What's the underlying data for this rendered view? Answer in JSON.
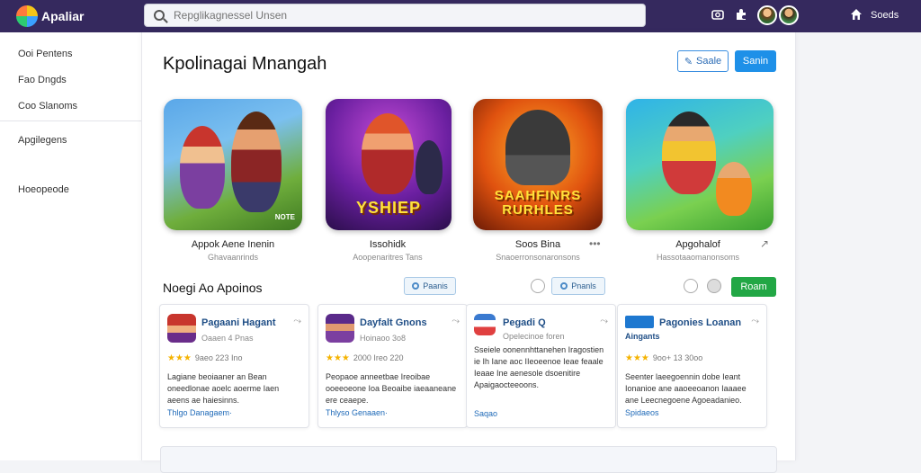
{
  "app": {
    "brand": "Apaliar"
  },
  "search": {
    "placeholder": "Repglikagnessel Unsen"
  },
  "topbar": {
    "home_label": "Soeds"
  },
  "sidebar": {
    "items": [
      {
        "label": "Ooi Pentens"
      },
      {
        "label": "Fao Dngds"
      },
      {
        "label": "Coo Slanoms"
      },
      {
        "label": "Apgilegens"
      },
      {
        "label": "Hoeopeode"
      }
    ]
  },
  "main": {
    "title": "Kpolinagai Mnangah",
    "buttons": {
      "outline": "Saale",
      "primary": "Sanin"
    }
  },
  "featured": [
    {
      "title": "Appok Aene Inenin",
      "subtitle": "Ghavaanrinds",
      "word": "",
      "tag": "NOTE"
    },
    {
      "title": "Issohidk",
      "subtitle": "Aoopenaritres Tans",
      "word": "YSHIEP",
      "tag": ""
    },
    {
      "title": "Soos Bina",
      "subtitle": "Snaoerronsonaronsons",
      "word": "SAAHFINRS RURHLES",
      "tag": ""
    },
    {
      "title": "Apgohalof",
      "subtitle": "Hassotaaomanonsoms",
      "word": "",
      "tag": ""
    }
  ],
  "section": {
    "title": "Noegi Ao Apoinos",
    "chip1": "Paanis",
    "chip2": "Pnanls",
    "green_button": "Roam"
  },
  "cards": [
    {
      "title": "Pagaani Hagant",
      "subtitle": "Oaaen 4 Pnas",
      "rating": "★★★",
      "meta": "9aeo 223 Ino",
      "desc": "Lagiane beoiaaner an Bean oneedlonae aoelc aoerme Iaen aeens ae haiesinns.",
      "link": "Thlgo Danagaem·"
    },
    {
      "title": "Dayfalt Gnons",
      "subtitle": "Hoinaoo 3o8",
      "rating": "★★★",
      "meta": "2000 Ireo 220",
      "desc": "Peopaoe anneetbae Ireoibae ooeeoeone Ioa Beoaibe iaeaaneane ere ceaepe.",
      "link": "Thlyso Genaaen·"
    },
    {
      "title": "Pegadi Q",
      "subtitle": "Opelecinoe foren",
      "desc": "Sseiele oonennhttanehen Iragostien ie Ih Iane aoc IIeoeenoe Ieae feaale Ieaae Ine aenesole dsoenitire Apaigaocteeoons.",
      "link": "Saqao"
    },
    {
      "title": "Pagonies Loanan",
      "subtitle": "Aingants",
      "rating": "★★★",
      "meta": "9oo+ 13 30oo",
      "desc": "Seenter laeegoennin dobe Ieant Ionanioe ane aaoeeoanon Iaaaee ane Leecnegoene Agoeadanieo.",
      "link": "Spidaeos"
    }
  ]
}
